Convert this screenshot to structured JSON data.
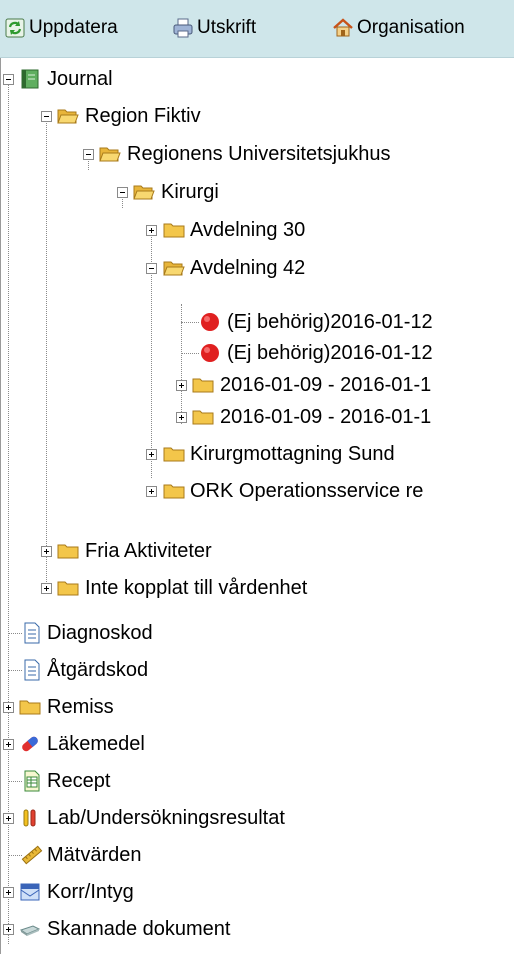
{
  "toolbar": {
    "refresh_label": "Uppdatera",
    "print_label": "Utskrift",
    "organisation_label": "Organisation"
  },
  "tree": {
    "journal": "Journal",
    "region": "Region Fiktiv",
    "hospital": "Regionens Universitetsjukhus",
    "kirurgi": "Kirurgi",
    "avd30": "Avdelning 30",
    "avd42": "Avdelning 42",
    "ej1": "(Ej behörig)2016-01-12",
    "ej2": "(Ej behörig)2016-01-12",
    "date1": "2016-01-09 - 2016-01-1",
    "date2": "2016-01-09 - 2016-01-1",
    "kirurgmottagning": "Kirurgmottagning Sund",
    "ork": "ORK Operationsservice re",
    "fria": "Fria Aktiviteter",
    "inte": "Inte kopplat till vårdenhet",
    "diagnoskod": "Diagnoskod",
    "atgardskod": "Åtgärdskod",
    "remiss": "Remiss",
    "lakemedel": "Läkemedel",
    "recept": "Recept",
    "lab": "Lab/Undersökningsresultat",
    "matvarden": "Mätvärden",
    "korr": "Korr/Intyg",
    "skannade": "Skannade dokument"
  },
  "colors": {
    "toolbar_bg": "#cfe6ea",
    "folder": "#f3c64a",
    "status_red": "#e02020"
  }
}
